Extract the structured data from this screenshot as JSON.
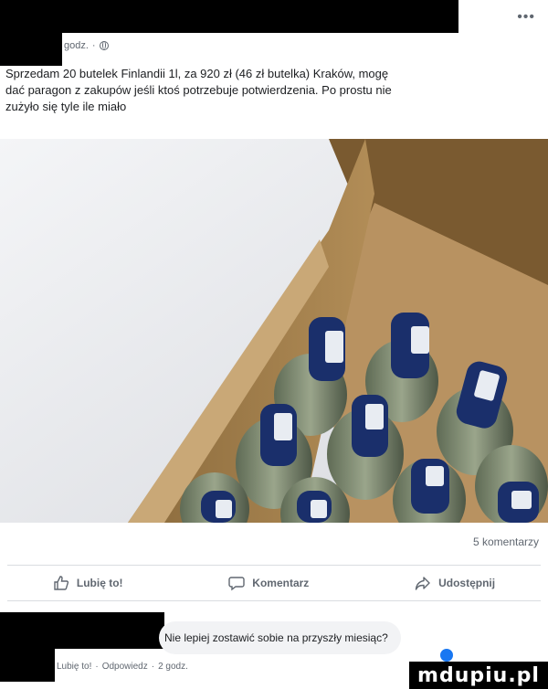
{
  "post": {
    "time": "godz.",
    "text_line1": "Sprzedam 20 butelek Finlandii 1l, za 920 zł (46 zł butelka) Kraków, mogę",
    "text_line2": "dać paragon z zakupów jeśli ktoś potrzebuje potwierdzenia. Po prostu nie",
    "text_line3": "zużyło się tyle ile miało",
    "more_icon": "more-options-icon",
    "privacy_icon": "globe-icon"
  },
  "stats": {
    "comments": "5 komentarzy"
  },
  "actions": {
    "like": "Lubię to!",
    "comment": "Komentarz",
    "share": "Udostępnij"
  },
  "comment": {
    "text": "Nie lepiej zostawić sobie na przyszły miesiąc?",
    "like": "Lubię to!",
    "reply": "Odpowiedz",
    "time": "2 godz."
  },
  "watermark": "mdupiu.pl",
  "colors": {
    "text": "#1c1e21",
    "muted": "#606770",
    "cardboard": "#a8844f",
    "cap_blue": "#1a2f6b"
  }
}
